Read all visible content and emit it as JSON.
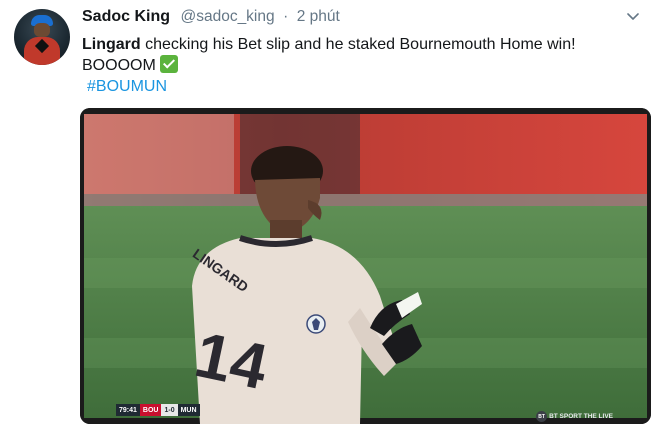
{
  "tweet": {
    "author_name": "Sadoc King",
    "handle": "@sadoc_king",
    "separator": "·",
    "time": "2 phút",
    "text_bold": "Lingard",
    "text_rest": " checking his Bet slip and he staked Bournemouth Home win!",
    "text_line2": "BOOOOM",
    "hashtag": "#BOUMUN"
  },
  "icons": {
    "avatar": "profile-photo",
    "menu": "chevron-down-icon",
    "emoji": "white-check-mark-icon"
  },
  "media": {
    "shirt_name": "LINGARD",
    "shirt_number": "14",
    "scorebug": {
      "clock": "79:41",
      "home": "BOU",
      "score": "1-0",
      "away": "MUN"
    },
    "broadcaster": "BT SPORT THE LIVE",
    "broadcaster_logo": "BT"
  },
  "colors": {
    "link": "#1b95e0",
    "muted": "#657786",
    "check_green": "#5bb33d"
  }
}
